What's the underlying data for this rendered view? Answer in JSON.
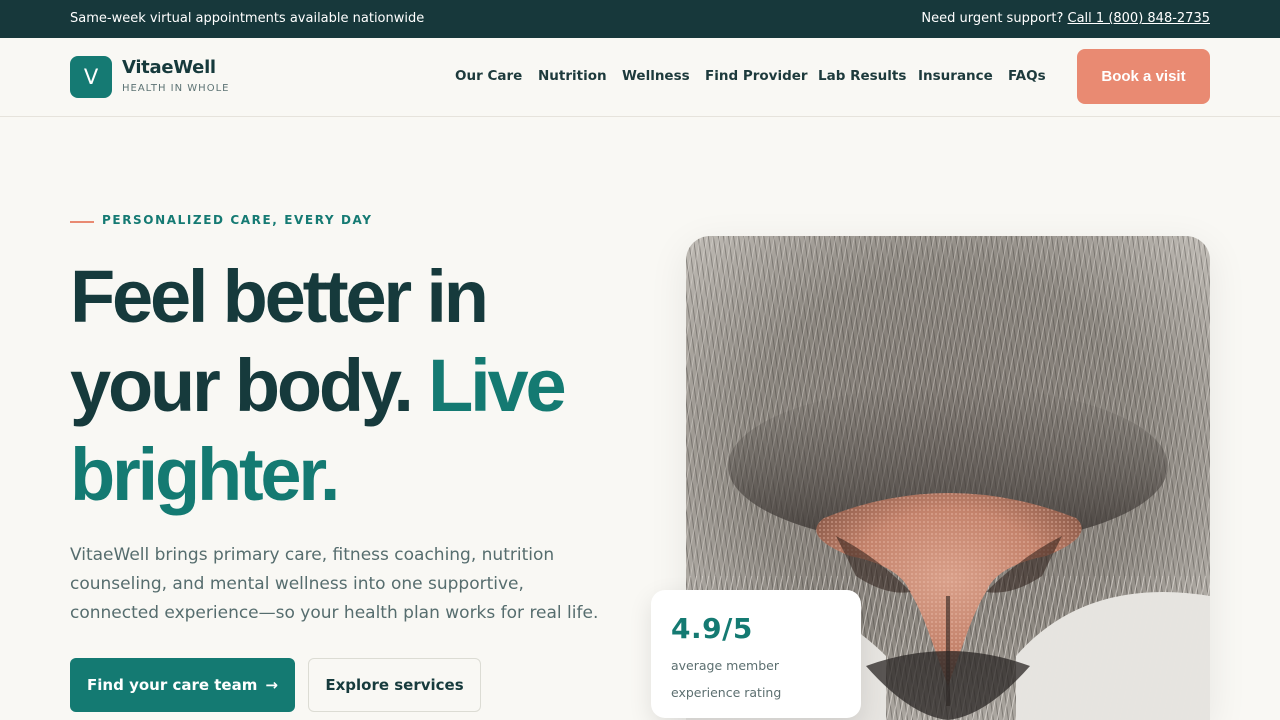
{
  "topbar": {
    "announcement": "Same-week virtual appointments available nationwide",
    "support_prefix": "Need urgent support?",
    "support_link": "Call 1 (800) 848-2735"
  },
  "brand": {
    "mark": "V",
    "name": "VitaeWell",
    "tagline": "HEALTH IN WHOLE"
  },
  "nav": {
    "items": [
      {
        "label": "Our Care"
      },
      {
        "label": "Nutrition"
      },
      {
        "label": "Wellness"
      },
      {
        "label": "Find Provider"
      },
      {
        "label": "Lab Results"
      },
      {
        "label": "Insurance"
      },
      {
        "label": "FAQs"
      }
    ],
    "cta": "Book a visit"
  },
  "hero": {
    "eyebrow": "PERSONALIZED CARE, EVERY DAY",
    "headline_line1": "Feel better in",
    "headline_line2_a": "your body.",
    "headline_line2_b": "Live",
    "headline_line3": "brighter.",
    "lede": "VitaeWell brings primary care, fitness coaching, nutrition counseling, and mental wellness into one supportive, connected experience—so your health plan works for real life.",
    "primary_cta": "Find your care team",
    "primary_cta_icon": "→",
    "secondary_cta": "Explore services"
  },
  "rating": {
    "value": "4.9/5",
    "label": "average member experience rating"
  },
  "colors": {
    "topbar": "#17383b",
    "brand_teal": "#147a72",
    "accent_coral": "#e98a72",
    "background": "#f9f8f4",
    "heading": "#163a3c"
  },
  "photo": {
    "subject": "close-up of a cat nose"
  }
}
